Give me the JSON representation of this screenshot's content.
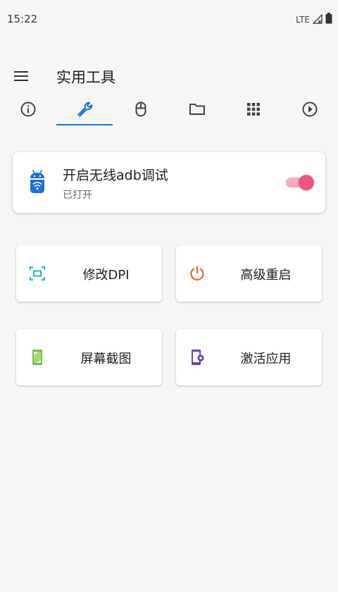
{
  "status_bar": {
    "time": "15:22",
    "network": "LTE"
  },
  "app_bar": {
    "title": "实用工具"
  },
  "tabs": [
    {
      "icon": "info-icon",
      "active": false
    },
    {
      "icon": "wrench-icon",
      "active": true
    },
    {
      "icon": "mouse-icon",
      "active": false
    },
    {
      "icon": "folder-icon",
      "active": false
    },
    {
      "icon": "apps-grid-icon",
      "active": false
    },
    {
      "icon": "play-circle-icon",
      "active": false
    }
  ],
  "adb_card": {
    "title": "开启无线adb调试",
    "subtitle": "已打开",
    "enabled": true,
    "icon": "android-wifi-icon"
  },
  "tools": [
    {
      "label": "修改DPI",
      "icon": "screen-resize-icon",
      "color": "#26b4d6"
    },
    {
      "label": "高级重启",
      "icon": "power-icon",
      "color": "#f0602c"
    },
    {
      "label": "屏幕截图",
      "icon": "screenshot-icon",
      "color": "#7cbf43"
    },
    {
      "label": "激活应用",
      "icon": "app-settings-icon",
      "color": "#6e3fb8"
    }
  ],
  "colors": {
    "accent": "#1976d2",
    "switch_thumb": "#f0557f",
    "switch_track": "#f8a7c1",
    "background": "#f6f6f6"
  }
}
